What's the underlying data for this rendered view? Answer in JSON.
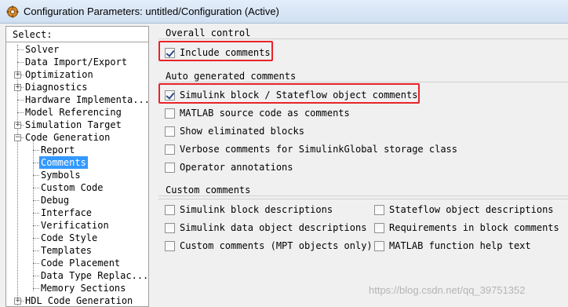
{
  "window": {
    "title": "Configuration Parameters: untitled/Configuration (Active)"
  },
  "tree": {
    "header": "Select:",
    "items": [
      {
        "label": "Solver",
        "expandable": false,
        "level": 1
      },
      {
        "label": "Data Import/Export",
        "expandable": false,
        "level": 1
      },
      {
        "label": "Optimization",
        "expandable": true,
        "level": 1
      },
      {
        "label": "Diagnostics",
        "expandable": true,
        "level": 1
      },
      {
        "label": "Hardware Implementa...",
        "expandable": false,
        "level": 1
      },
      {
        "label": "Model Referencing",
        "expandable": false,
        "level": 1
      },
      {
        "label": "Simulation Target",
        "expandable": true,
        "level": 1
      },
      {
        "label": "Code Generation",
        "expandable": true,
        "expanded": true,
        "level": 1
      },
      {
        "label": "Report",
        "level": 2
      },
      {
        "label": "Comments",
        "level": 2,
        "selected": true
      },
      {
        "label": "Symbols",
        "level": 2
      },
      {
        "label": "Custom Code",
        "level": 2
      },
      {
        "label": "Debug",
        "level": 2
      },
      {
        "label": "Interface",
        "level": 2
      },
      {
        "label": "Verification",
        "level": 2
      },
      {
        "label": "Code Style",
        "level": 2
      },
      {
        "label": "Templates",
        "level": 2
      },
      {
        "label": "Code Placement",
        "level": 2
      },
      {
        "label": "Data Type Replac...",
        "level": 2
      },
      {
        "label": "Memory Sections",
        "level": 2
      },
      {
        "label": "HDL Code Generation",
        "expandable": true,
        "level": 1
      }
    ]
  },
  "overall": {
    "title": "Overall control",
    "include_comments": {
      "label": "Include comments",
      "checked": true
    }
  },
  "auto": {
    "title": "Auto generated comments",
    "items": [
      {
        "label": "Simulink block / Stateflow object comments",
        "checked": true
      },
      {
        "label": "MATLAB source code as comments",
        "checked": false
      },
      {
        "label": "Show eliminated blocks",
        "checked": false
      },
      {
        "label": "Verbose comments for SimulinkGlobal storage class",
        "checked": false
      },
      {
        "label": "Operator annotations",
        "checked": false
      }
    ]
  },
  "custom": {
    "title": "Custom comments",
    "left": [
      {
        "label": "Simulink block descriptions",
        "checked": false
      },
      {
        "label": "Simulink data object descriptions",
        "checked": false
      },
      {
        "label": "Custom comments (MPT objects only)",
        "checked": false
      }
    ],
    "right": [
      {
        "label": "Stateflow object descriptions",
        "checked": false
      },
      {
        "label": "Requirements in block comments",
        "checked": false
      },
      {
        "label": "MATLAB function help text",
        "checked": false
      }
    ]
  },
  "watermark": "https://blog.csdn.net/qq_39751352",
  "colors": {
    "selection": "#3399ff",
    "highlight_box": "#e8232a",
    "background": "#f0f0f0"
  }
}
